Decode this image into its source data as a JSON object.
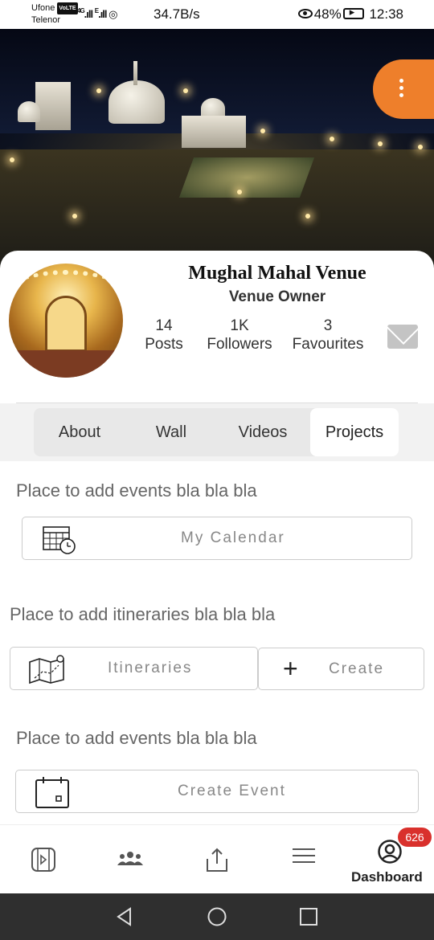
{
  "status_bar": {
    "carrier_1": "Ufone",
    "volte_badge": "VoLTE",
    "carrier_2": "Telenor",
    "network_type_1": "4G",
    "network_type_2": "E",
    "net_speed": "34.7B/s",
    "battery": "48%",
    "time": "12:38"
  },
  "header": {
    "menu_icon": "vertical-dots-icon",
    "accent_color": "#ee7f2b"
  },
  "profile": {
    "name": "Mughal Mahal Venue",
    "role": "Venue Owner",
    "stats": [
      {
        "value": "14",
        "label": "Posts"
      },
      {
        "value": "1K",
        "label": "Followers"
      },
      {
        "value": "3",
        "label": "Favourites"
      }
    ],
    "message_icon": "mail-icon"
  },
  "tabs": [
    {
      "label": "About",
      "active": false
    },
    {
      "label": "Wall",
      "active": false
    },
    {
      "label": "Videos",
      "active": false
    },
    {
      "label": "Projects",
      "active": true
    }
  ],
  "sections": {
    "events_note": "Place to add events bla bla bla",
    "calendar_label": "My Calendar",
    "itineraries_note": "Place to add itineraries bla bla bla",
    "itineraries_label": "Itineraries",
    "create_label": "Create",
    "events_note_2": "Place to add events bla bla bla",
    "create_event_label": "Create Event"
  },
  "bottom_nav": {
    "items": [
      {
        "icon": "media-player-icon"
      },
      {
        "icon": "group-icon"
      },
      {
        "icon": "share-icon"
      },
      {
        "icon": "hamburger-menu-icon"
      }
    ],
    "dashboard_label": "Dashboard",
    "dashboard_badge": "626",
    "badge_color": "#d9302c"
  }
}
